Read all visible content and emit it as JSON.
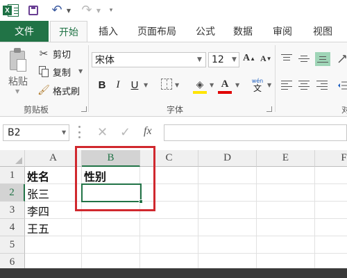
{
  "quick_access": {
    "logo_letter": "X",
    "icons": [
      "excel-logo",
      "save-icon",
      "undo-icon",
      "redo-icon",
      "customize-icon"
    ]
  },
  "ribbon_tabs": {
    "file": "文件",
    "home": "开始",
    "insert": "插入",
    "page_layout": "页面布局",
    "formulas": "公式",
    "data": "数据",
    "review": "审阅",
    "view": "视图"
  },
  "clipboard": {
    "paste": "粘贴",
    "cut": "剪切",
    "copy": "复制",
    "format_painter": "格式刷",
    "group_label": "剪贴板"
  },
  "font": {
    "name": "宋体",
    "size": "12",
    "grow_glyph": "A",
    "shrink_glyph": "A",
    "bold": "B",
    "italic": "I",
    "underline": "U",
    "font_color_glyph": "A",
    "phonetic_top": "wén",
    "phonetic_char": "文",
    "group_label": "字体",
    "fill_color": "#ffe500",
    "font_color": "#e00000"
  },
  "alignment": {
    "group_label_partial": "对"
  },
  "formula_bar": {
    "name_box": "B2",
    "cancel_glyph": "✕",
    "enter_glyph": "✓",
    "fx": "fx",
    "formula": ""
  },
  "sheet": {
    "columns": [
      "A",
      "B",
      "C",
      "D",
      "E",
      "F"
    ],
    "rows": [
      "1",
      "2",
      "3",
      "4",
      "5",
      "6"
    ],
    "selected_column": "B",
    "selected_row": "2",
    "cells": {
      "A1": "姓名",
      "B1": "性别",
      "A2": "张三",
      "A3": "李四",
      "A4": "王五"
    }
  },
  "colors": {
    "accent": "#217346",
    "highlight_box": "#d0282e"
  }
}
